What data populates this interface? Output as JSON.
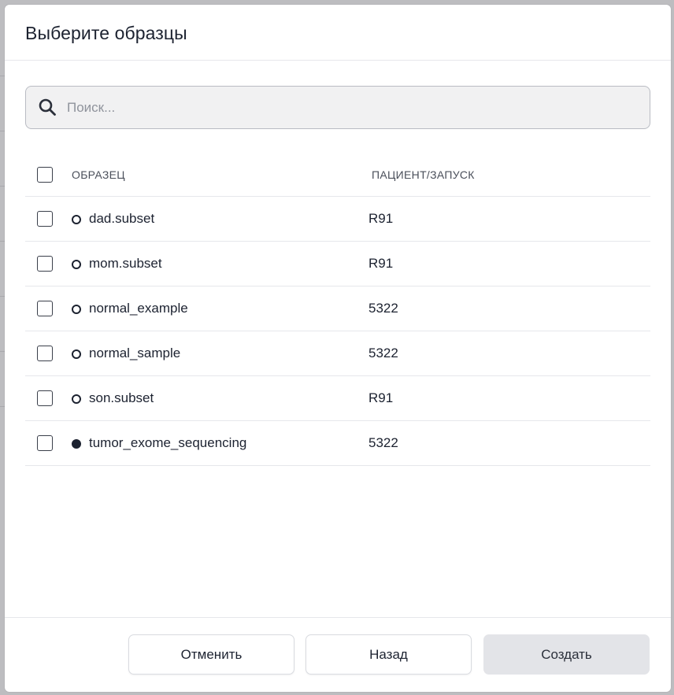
{
  "dialog": {
    "title": "Выберите образцы"
  },
  "search": {
    "placeholder": "Поиск...",
    "value": ""
  },
  "table": {
    "columns": {
      "sample": "ОБРАЗЕЦ",
      "patient": "ПАЦИЕНТ/ЗАПУСК"
    },
    "rows": [
      {
        "name": "dad.subset",
        "patient": "R91",
        "status": "open"
      },
      {
        "name": "mom.subset",
        "patient": "R91",
        "status": "open"
      },
      {
        "name": "normal_example",
        "patient": "5322",
        "status": "open"
      },
      {
        "name": "normal_sample",
        "patient": "5322",
        "status": "open"
      },
      {
        "name": "son.subset",
        "patient": "R91",
        "status": "open"
      },
      {
        "name": "tumor_exome_sequencing",
        "patient": "5322",
        "status": "filled"
      }
    ]
  },
  "footer": {
    "cancel_label": "Отменить",
    "back_label": "Назад",
    "create_label": "Создать"
  },
  "icons": {
    "search": "search-icon",
    "status_open": "circle-outline-icon",
    "status_filled": "circle-filled-icon"
  },
  "colors": {
    "text": "#1c2230",
    "border": "#e6e7eb",
    "create_button_bg": "#e3e4e8"
  }
}
